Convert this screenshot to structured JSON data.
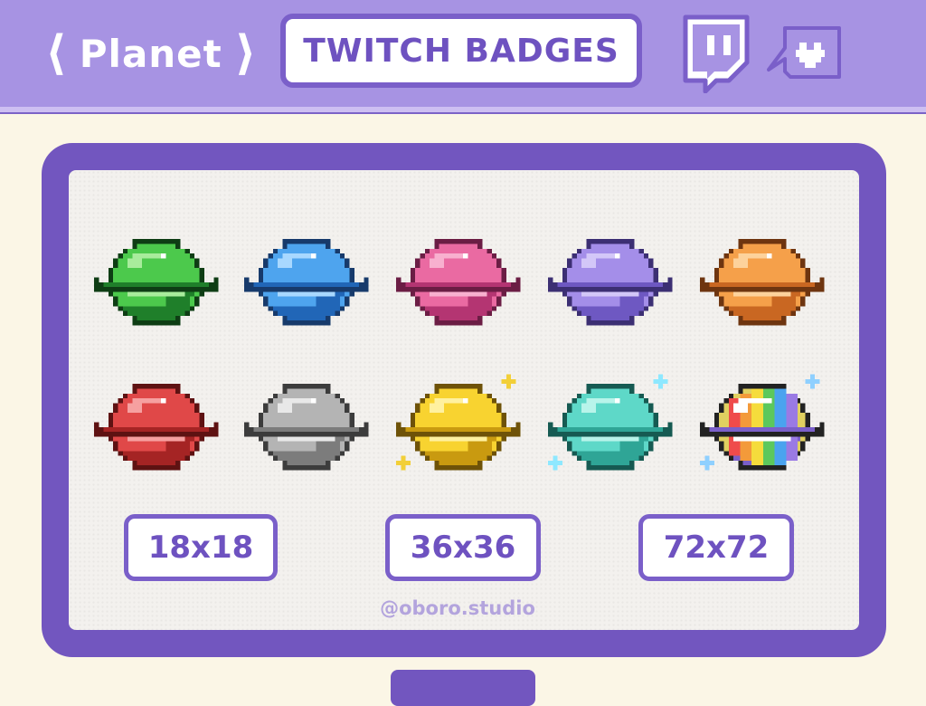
{
  "header": {
    "title": "Planet",
    "chevron_left": "⟨",
    "chevron_right": "⟩",
    "banner": "TWITCH BADGES",
    "icons": [
      "twitch-logo-icon",
      "heart-chat-bubble-icon"
    ]
  },
  "colors": {
    "header_bg": "#a793e3",
    "frame": "#7256bf",
    "accent_text": "#6e52c0",
    "page_bg": "#fbf6e6"
  },
  "badges": [
    {
      "name": "planet-green-icon",
      "main": "#4cc94c",
      "light": "#a8ec9c",
      "dark": "#1f7f2a",
      "outline": "#0e3d14"
    },
    {
      "name": "planet-blue-icon",
      "main": "#4ea4ee",
      "light": "#a8d8ff",
      "dark": "#2166b7",
      "outline": "#173a6b"
    },
    {
      "name": "planet-pink-icon",
      "main": "#ea6aa2",
      "light": "#f8b0cf",
      "dark": "#b43572",
      "outline": "#6b1d44"
    },
    {
      "name": "planet-purple-icon",
      "main": "#a48ee9",
      "light": "#d3c7f8",
      "dark": "#6e58c2",
      "outline": "#3c2f73"
    },
    {
      "name": "planet-orange-icon",
      "main": "#f5a04a",
      "light": "#fdd29c",
      "dark": "#c96722",
      "outline": "#6e3510"
    },
    {
      "name": "planet-red-icon",
      "main": "#e04848",
      "light": "#f6a0a0",
      "dark": "#a52424",
      "outline": "#5e1212"
    },
    {
      "name": "planet-silver-icon",
      "main": "#b4b4b4",
      "light": "#e8e8e8",
      "dark": "#7c7c7c",
      "outline": "#3c3c3c"
    },
    {
      "name": "planet-gold-icon",
      "main": "#f8d330",
      "light": "#fff1a0",
      "dark": "#c99a10",
      "outline": "#6e5208",
      "sparkle": "#f2cf38"
    },
    {
      "name": "planet-teal-icon",
      "main": "#5ed8c8",
      "light": "#b8f4ea",
      "dark": "#2fa596",
      "outline": "#165a52",
      "sparkle": "#8ee8ff"
    },
    {
      "name": "planet-rainbow-icon",
      "main": "#e0d060",
      "light": "#ffffff",
      "dark": "#7a5fc9",
      "outline": "#222222",
      "sparkle": "#8fd0ff",
      "stripes": [
        "#ef4b4b",
        "#f39a3a",
        "#f5dc3c",
        "#5cc85c",
        "#4aa3ef",
        "#9a7ae4"
      ]
    }
  ],
  "sizes": [
    "18x18",
    "36x36",
    "72x72"
  ],
  "watermark": "@oboro.studio"
}
